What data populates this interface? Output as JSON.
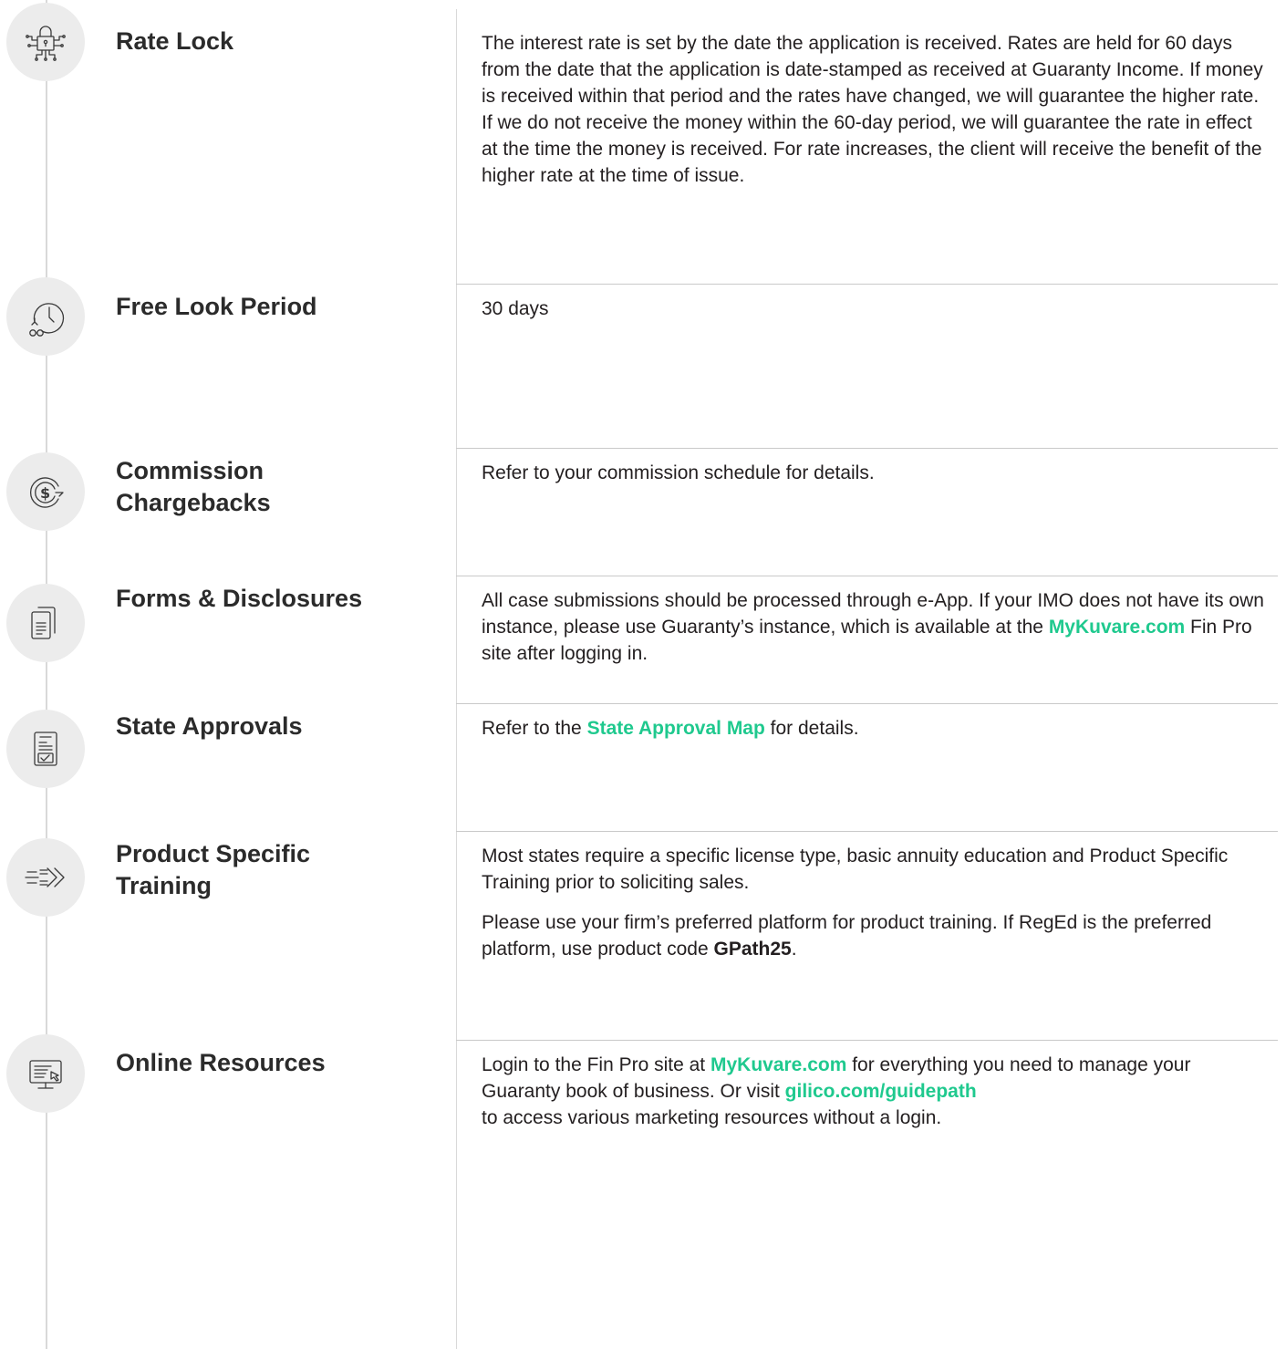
{
  "rows": [
    {
      "icon": "circuit-lock-icon",
      "title": "Rate Lock",
      "text": "The interest rate is set by the date the application is received. Rates are held for 60 days from the date that the application is date-stamped as received at Guaranty Income. If money is received within that period and the rates have changed, we will guarantee the higher rate. If we do not receive the money within the 60-day period, we will guarantee the rate in effect at the time the money is received. For rate increases, the client will receive the benefit of the higher rate at the time of issue."
    },
    {
      "icon": "clock-glasses-icon",
      "title": "Free Look Period",
      "text": "30 days"
    },
    {
      "icon": "dollar-cycle-icon",
      "title_line1": "Commission",
      "title_line2": "Chargebacks",
      "text": "Refer to your commission schedule for details."
    },
    {
      "icon": "documents-icon",
      "title": "Forms & Disclosures",
      "text_before": "All case submissions should be processed through e-App. If your IMO does not have its own instance, please use Guaranty’s instance, which is available at the ",
      "link": "MyKuvare.com",
      "text_after": " Fin Pro site after logging in."
    },
    {
      "icon": "checklist-icon",
      "title": "State Approvals",
      "text_before": "Refer to the ",
      "link": "State Approval Map",
      "text_after": " for details."
    },
    {
      "icon": "fast-forward-arrows-icon",
      "title_line1": "Product Specific",
      "title_line2": "Training",
      "para1": "Most states require a specific license type, basic annuity education and Product Specific Training prior to soliciting sales.",
      "para2_before": "Please use your firm’s preferred platform for product training. If RegEd is the preferred platform, use product code ",
      "code": "GPath25",
      "para2_after": "."
    },
    {
      "icon": "monitor-cursor-icon",
      "title": "Online Resources",
      "text_before": "Login to the Fin Pro site at ",
      "link1": "MyKuvare.com",
      "text_middle": " for everything you need to manage your Guaranty book of business. Or visit ",
      "link2": "gilico.com/guidepath",
      "text_after": " to access various marketing resources without a login."
    }
  ]
}
